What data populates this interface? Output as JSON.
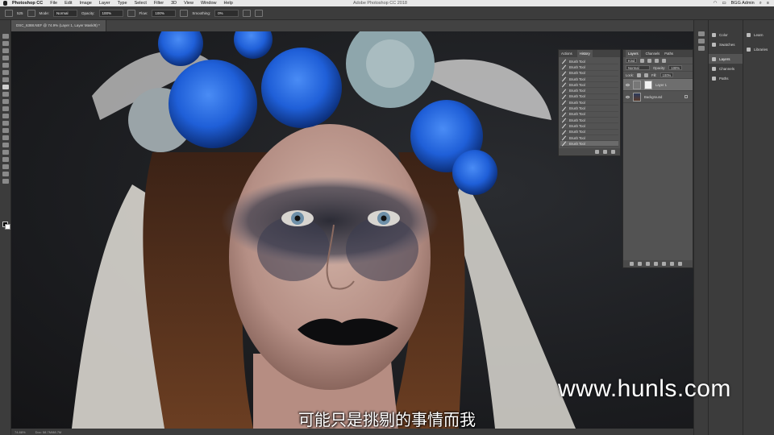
{
  "menubar": {
    "app_name": "Photoshop CC",
    "menus": [
      "File",
      "Edit",
      "Image",
      "Layer",
      "Type",
      "Select",
      "Filter",
      "3D",
      "View",
      "Window",
      "Help"
    ],
    "window_title": "Adobe Photoshop CC 2018",
    "user": "BGG Admin"
  },
  "options_bar": {
    "brush_size": "525",
    "mode_label": "Mode:",
    "mode_value": "Normal",
    "opacity_label": "Opacity:",
    "opacity_value": "100%",
    "flow_label": "Flow:",
    "flow_value": "100%",
    "smoothing_label": "Smoothing:",
    "smoothing_value": "0%"
  },
  "document": {
    "tab_title": "DSC_6388.NEF @ 74.9% (Layer 1, Layer Mask/8) *",
    "zoom": "74.88%",
    "doc_size": "Doc: 58.7M/88.7M"
  },
  "history_panel": {
    "tabs": [
      "Actions",
      "History"
    ],
    "active_tab": "History",
    "items": [
      "Brush Tool",
      "Brush Tool",
      "Brush Tool",
      "Brush Tool",
      "Brush Tool",
      "Brush Tool",
      "Brush Tool",
      "Brush Tool",
      "Brush Tool",
      "Brush Tool",
      "Brush Tool",
      "Brush Tool",
      "Brush Tool",
      "Brush Tool",
      "Brush Tool"
    ],
    "selected_index": 14
  },
  "layers_panel": {
    "tabs": [
      "Layers",
      "Channels",
      "Paths"
    ],
    "active_tab": "Layers",
    "kind_label": "Kind",
    "blend_mode": "Normal",
    "opacity_label": "Opacity:",
    "opacity_value": "100%",
    "lock_label": "Lock:",
    "fill_label": "Fill:",
    "fill_value": "100%",
    "layers": [
      {
        "name": "Layer 1",
        "selected": true
      },
      {
        "name": "Background",
        "selected": false
      }
    ]
  },
  "dock_middle": {
    "items": [
      "Color",
      "Swatches",
      "Layers",
      "Channels",
      "Paths"
    ],
    "highlighted": "Layers"
  },
  "dock_right": {
    "items": [
      "Learn",
      "Libraries"
    ]
  },
  "overlay": {
    "watermark": "www.hunls.com",
    "subtitle": "可能只是挑剔的事情而我"
  },
  "colors": {
    "ui_dark": "#3c3c3c",
    "panel": "#535353",
    "flower_blue": "#1f5fd8",
    "lipstick": "#0d0d0f"
  }
}
